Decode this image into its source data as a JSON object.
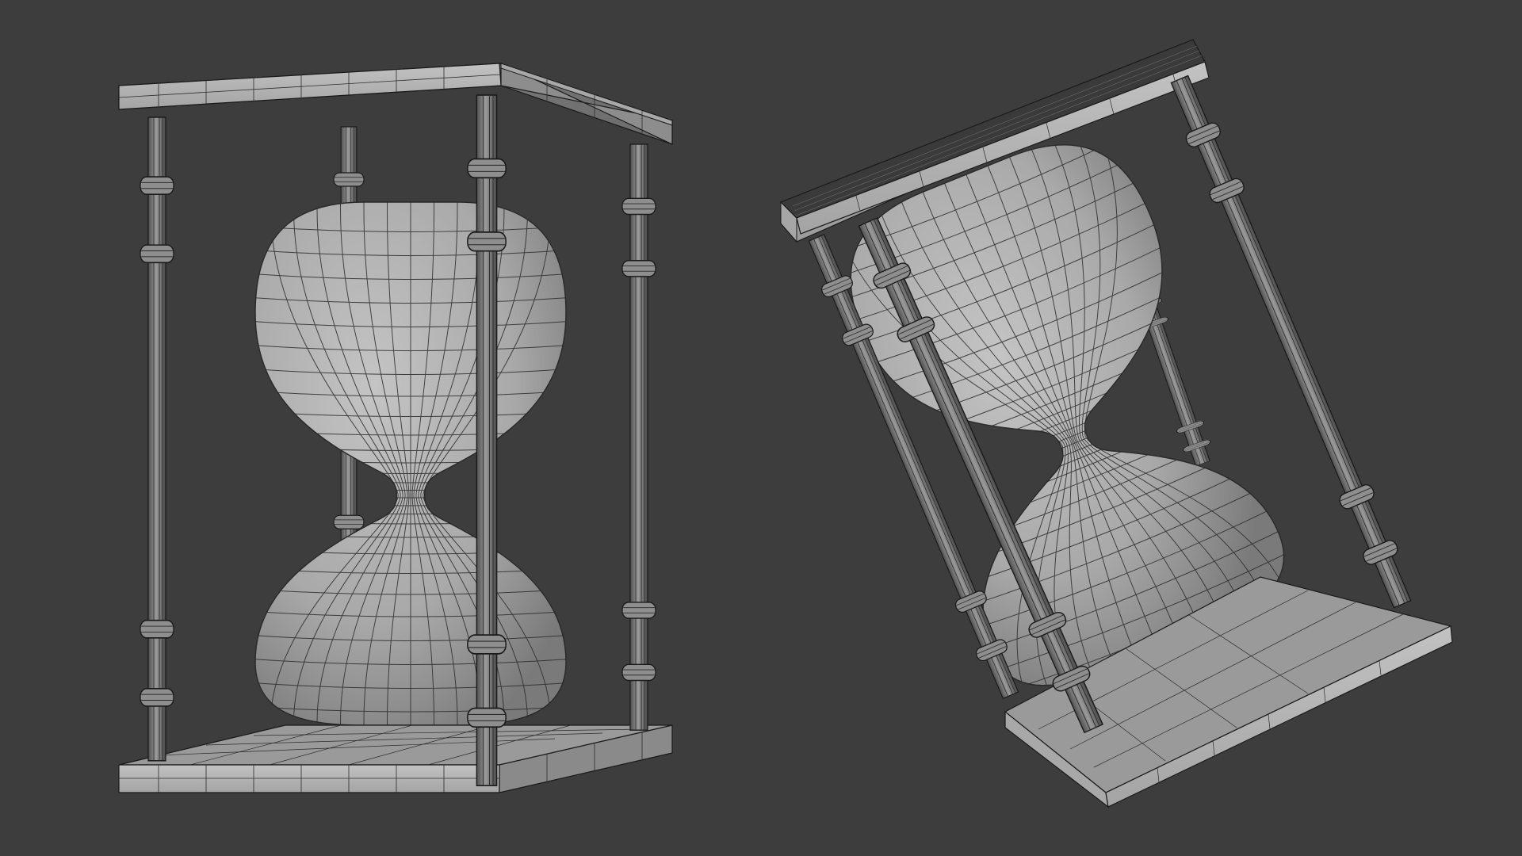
{
  "scene": {
    "background_color": "#3d3d3d",
    "wire_color": "#1e1e1e",
    "surface_light": "#bdbdbd",
    "surface_mid": "#a2a2a2",
    "surface_dark": "#6a6a6a",
    "objects": [
      {
        "name": "hourglass-upright",
        "orientation": "upright"
      },
      {
        "name": "hourglass-tilted",
        "orientation": "tilted"
      }
    ]
  }
}
